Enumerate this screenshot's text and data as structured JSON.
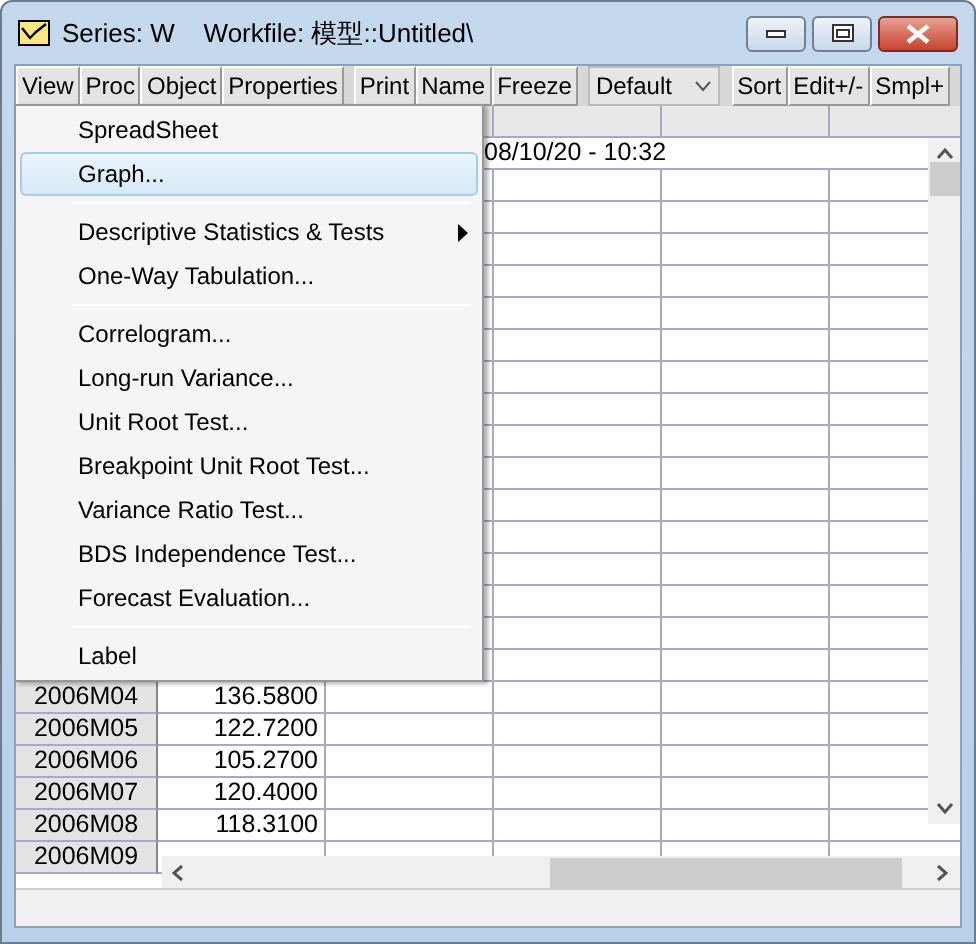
{
  "window": {
    "title": "Series: W    Workfile: 模型::Untitled\\"
  },
  "toolbar": [
    {
      "kind": "buttons",
      "labels": [
        "View",
        "Proc",
        "Object",
        "Properties"
      ]
    },
    {
      "kind": "buttons",
      "labels": [
        "Print",
        "Name",
        "Freeze"
      ]
    },
    {
      "kind": "dropdown",
      "value": "Default"
    },
    {
      "kind": "buttons",
      "labels": [
        "Sort",
        "Edit+/-",
        "Smpl+"
      ]
    }
  ],
  "sheet": {
    "info": "08/10/20 - 10:32",
    "rows": [
      {
        "label": "2006M04",
        "value": "136.5800"
      },
      {
        "label": "2006M05",
        "value": "122.7200"
      },
      {
        "label": "2006M06",
        "value": "105.2700"
      },
      {
        "label": "2006M07",
        "value": "120.4000"
      },
      {
        "label": "2006M08",
        "value": "118.3100"
      },
      {
        "label": "2006M09",
        "value": ""
      }
    ]
  },
  "menu": [
    {
      "kind": "item",
      "label": "SpreadSheet",
      "selected": false,
      "submenu": false
    },
    {
      "kind": "item",
      "label": "Graph...",
      "selected": true,
      "submenu": false
    },
    {
      "kind": "separator"
    },
    {
      "kind": "item",
      "label": "Descriptive Statistics & Tests",
      "selected": false,
      "submenu": true
    },
    {
      "kind": "item",
      "label": "One-Way Tabulation...",
      "selected": false,
      "submenu": false
    },
    {
      "kind": "separator"
    },
    {
      "kind": "item",
      "label": "Correlogram...",
      "selected": false,
      "submenu": false
    },
    {
      "kind": "item",
      "label": "Long-run Variance...",
      "selected": false,
      "submenu": false
    },
    {
      "kind": "item",
      "label": "Unit Root Test...",
      "selected": false,
      "submenu": false
    },
    {
      "kind": "item",
      "label": "Breakpoint Unit Root Test...",
      "selected": false,
      "submenu": false
    },
    {
      "kind": "item",
      "label": "Variance Ratio Test...",
      "selected": false,
      "submenu": false
    },
    {
      "kind": "item",
      "label": "BDS Independence Test...",
      "selected": false,
      "submenu": false
    },
    {
      "kind": "item",
      "label": "Forecast Evaluation...",
      "selected": false,
      "submenu": false
    },
    {
      "kind": "separator"
    },
    {
      "kind": "item",
      "label": "Label",
      "selected": false,
      "submenu": false
    }
  ]
}
